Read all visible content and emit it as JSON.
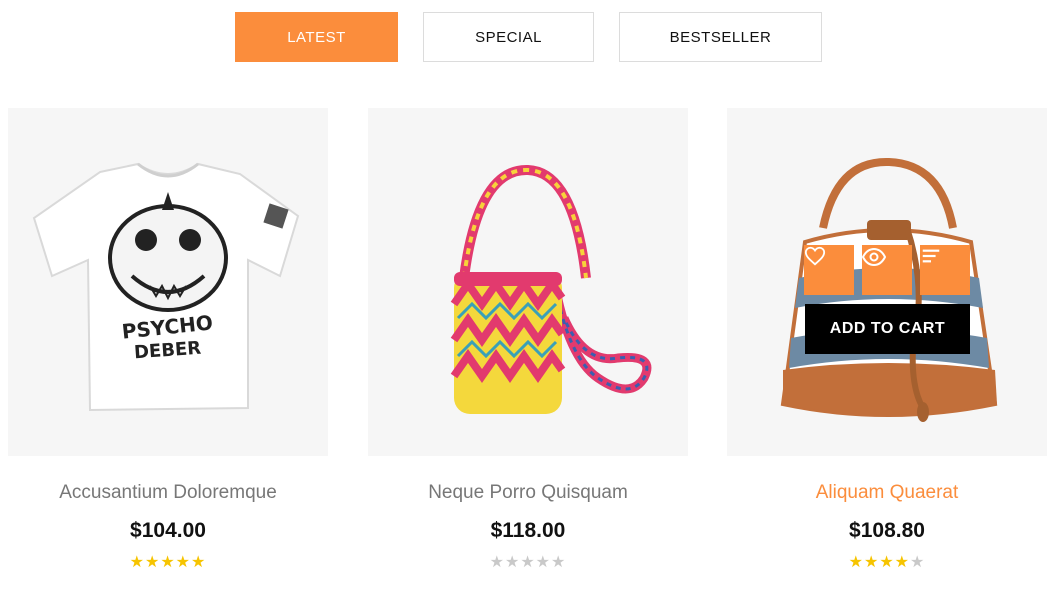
{
  "tabs": [
    {
      "label": "LATEST",
      "active": true
    },
    {
      "label": "SPECIAL",
      "active": false
    },
    {
      "label": "BESTSELLER",
      "active": false
    }
  ],
  "products": [
    {
      "name": "Accusantium Doloremque",
      "price": "$104.00",
      "rating": 5,
      "image_icon": "tshirt-image"
    },
    {
      "name": "Neque Porro Quisquam",
      "price": "$118.00",
      "rating": 0,
      "image_icon": "woven-bag-image"
    },
    {
      "name": "Aliquam Quaerat",
      "price": "$108.80",
      "rating": 4,
      "image_icon": "bucket-bag-image"
    }
  ],
  "hover_actions": {
    "wishlist_icon": "heart-icon",
    "quickview_icon": "eye-icon",
    "compare_icon": "list-icon",
    "add_to_cart_label": "ADD TO CART"
  },
  "colors": {
    "accent": "#fb8d3c",
    "star_on": "#f6c400",
    "star_off": "#c9c9c9",
    "price": "#111111",
    "title": "#777777"
  }
}
